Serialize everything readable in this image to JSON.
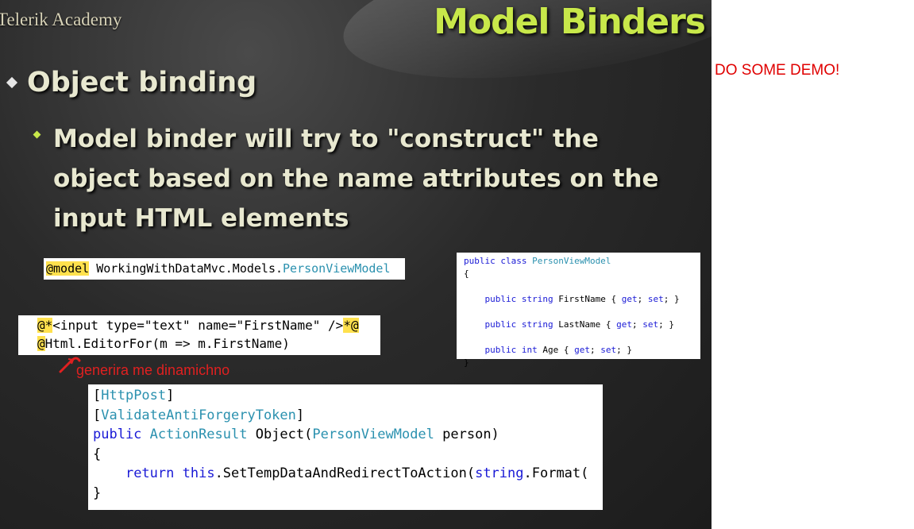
{
  "slide": {
    "logo": "Telerik Academy",
    "title": "Model Binders",
    "bullet1": "Object binding",
    "bullet2": "Model binder will try to \"construct\" the object based on the name attributes on the input HTML elements"
  },
  "code1": {
    "at_model": "@model",
    "ns": " WorkingWithDataMvc.Models.",
    "type": "PersonViewModel"
  },
  "code2": {
    "line1_at": "@*",
    "line1_text": "<input type=\"text\" name=\"FirstName\" />",
    "line1_end": "*@",
    "line2_at": "@",
    "line2_text": "Html.EditorFor(m => m.FirstName)"
  },
  "code3": {
    "l1_kw": "public class ",
    "l1_type": "PersonViewModel",
    "l2": "{",
    "l3_kw": "    public string ",
    "l3_name": "FirstName { ",
    "l3_get": "get",
    "l3_sep": "; ",
    "l3_set": "set",
    "l3_end": "; }",
    "l4_kw": "    public string ",
    "l4_name": "LastName { ",
    "l5_kw": "    public int ",
    "l5_name": "Age { ",
    "l6": "}"
  },
  "code4": {
    "attr1": "HttpPost",
    "attr2": "ValidateAntiForgeryToken",
    "sig_kw": "public ",
    "sig_ret": "ActionResult",
    "sig_name": " Object(",
    "sig_param_type": "PersonViewModel",
    "sig_param": " person)",
    "brace_open": "{",
    "ret_kw": "return ",
    "ret_this": "this",
    "ret_call": ".SetTempDataAndRedirectToAction(",
    "ret_string": "string",
    "ret_format": ".Format(",
    "brace_close": "}"
  },
  "annotation": "generira me dinamichno",
  "note": "DO SOME DEMO!",
  "colors": {
    "title": "#c8e84a",
    "annotation": "#e02020",
    "note": "#e00000"
  }
}
